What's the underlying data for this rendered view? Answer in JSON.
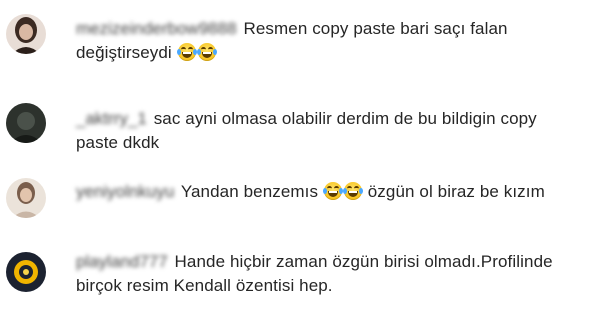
{
  "comments": [
    {
      "username": "mezizeinderbow9888",
      "text_before": "Resmen copy paste bari saçı falan değiştirseydi",
      "emojis": [
        "face-with-tears-of-joy-emoji",
        "face-with-tears-of-joy-emoji"
      ],
      "text_after": "",
      "avatar_colors": [
        "#d8c3b6",
        "#3b2a22"
      ]
    },
    {
      "username": "_aktrry_1",
      "text_before": "sac ayni olmasa olabilir derdim de bu bildigin copy paste dkdk",
      "emojis": [],
      "text_after": "",
      "avatar_colors": [
        "#3a3f3a",
        "#1e221e"
      ]
    },
    {
      "username": "yeniyolnkuyu",
      "text_before": "Yandan benzemıs",
      "emojis": [
        "face-with-tears-of-joy-emoji",
        "face-with-tears-of-joy-emoji"
      ],
      "text_after": "özgün ol biraz be kızım",
      "avatar_colors": [
        "#e6dcd2",
        "#7a5e4c"
      ]
    },
    {
      "username": "playland777",
      "text_before": "Hande hiçbir zaman özgün birisi olmadı.Profilinde birçok resim Kendall özentisi hep.",
      "emojis": [],
      "text_after": "",
      "avatar_colors": [
        "#f0b400",
        "#1c2230"
      ]
    }
  ]
}
